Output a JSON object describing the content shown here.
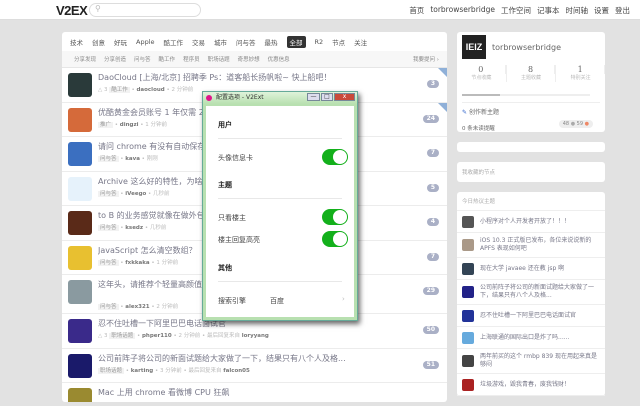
{
  "header": {
    "logo": "V2EX",
    "search_placeholder": "",
    "nav": [
      "首页",
      "torbrowserbridge",
      "工作空间",
      "记事本",
      "时间轴",
      "设置",
      "登出"
    ]
  },
  "tabs": [
    "技术",
    "创意",
    "好玩",
    "Apple",
    "酷工作",
    "交易",
    "城市",
    "问与答",
    "最热",
    "全部",
    "R2",
    "节点",
    "关注"
  ],
  "active_tab": "全部",
  "subtabs": [
    "分享发现",
    "分享创造",
    "问与答",
    "酷工作",
    "程序员",
    "职场话题",
    "奇思妙想",
    "优惠信息"
  ],
  "subtabs_more": "我要提问 ›",
  "topics": [
    {
      "title": "DaoCloud [上海/北京] 招聘季 Ps：道客船长扬帆啦~ 快上船吧！",
      "votes": "△ 3",
      "node": "酷工作",
      "user": "daocloud",
      "time": "2 分钟前",
      "last": "",
      "count": "3",
      "color": "#2a3a3a"
    },
    {
      "title": "优酷黄金会员账号 1 年仅需 2",
      "votes": "",
      "node": "推广",
      "user": "dingzi",
      "time": "1 分钟前",
      "last": "",
      "count": "24",
      "color": "#d56a3a"
    },
    {
      "title": "请问 chrome 有没有自动保存",
      "votes": "",
      "node": "问与答",
      "user": "kava",
      "time": "刚刚",
      "last": "",
      "count": "7",
      "color": "#3b6fc0"
    },
    {
      "title": "Archive 这么好的特性，为啥",
      "votes": "",
      "node": "问与答",
      "user": "iVeego",
      "time": "几秒前",
      "last": "",
      "count": "5",
      "color": "#e6f2fb"
    },
    {
      "title": "to B 的业务感觉就像在做外包",
      "votes": "",
      "node": "问与答",
      "user": "ksedz",
      "time": "几秒前",
      "last": "",
      "count": "4",
      "color": "#5a2a18"
    },
    {
      "title": "JavaScript 怎么清空数组？",
      "votes": "",
      "node": "问与答",
      "user": "fxkkaka",
      "time": "1 分钟前",
      "last": "",
      "count": "7",
      "color": "#e8c030"
    },
    {
      "title": "这年头，请推荐个轻量高颜值 get.adobe.com/cn/reader/) 109M 啊。。。",
      "votes": "",
      "node": "问与答",
      "user": "alex321",
      "time": "2 分钟前",
      "last": "",
      "count": "29",
      "color": "#8a9aa0",
      "tall": true
    },
    {
      "title": "忍不住吐槽一下阿里巴巴电话面试官",
      "votes": "△ 3",
      "node": "职场话题",
      "user": "phper110",
      "time": "2 分钟前",
      "last": "loryyang",
      "count": "50",
      "color": "#3a2a8a"
    },
    {
      "title": "公司前阵子将公司的新面试题给大家做了一下，结果只有八个人及格...",
      "votes": "",
      "node": "职场话题",
      "user": "karting",
      "time": "3 分钟前",
      "last": "falcon05",
      "count": "51",
      "color": "#1a1a6a"
    },
    {
      "title": "Mac 上用 chrome 看微博 CPU 狂飙",
      "votes": "",
      "node": "",
      "user": "",
      "time": "",
      "last": "",
      "count": "",
      "color": "#9a8a30"
    }
  ],
  "meta_labels": {
    "last_reply": "最后回复来自"
  },
  "profile": {
    "avatar_text": "IEIZ",
    "name": "torbrowserbridge",
    "stats": [
      {
        "n": "0",
        "l": "节点收藏"
      },
      {
        "n": "8",
        "l": "主题收藏"
      },
      {
        "n": "1",
        "l": "特别关注"
      }
    ],
    "progress": 0.3,
    "create": "创作新主题",
    "unread": "0 条未读提醒",
    "silver": "48",
    "bronze": "59"
  },
  "fav_nodes": "我收藏的节点",
  "hot": {
    "title": "今日热议主题",
    "items": [
      "小程序对个人开发者开放了！！！",
      "iOS 10.3 正式版已发布，各位来说说新的 APFS 表现如何吧",
      "现在大学 javaee 还在教 jsp 啊",
      "公司前阵子将公司的新面试题给大家做了一下，结果只有八个人及格...",
      "忍不住吐槽一下阿里巴巴电话面试官",
      "上海联通的国际出口是炸了吗......",
      "两年前买的这个 rmbp 839 现在用起来真是够闷",
      "垃圾游戏，毁我青春，废我钱财！"
    ],
    "colors": [
      "#555",
      "#a98",
      "#345",
      "#228",
      "#239",
      "#6ad",
      "#444",
      "#a22"
    ]
  },
  "dialog": {
    "title": "配置选项 - V2Ext",
    "min": "—",
    "max": "□",
    "close": "x",
    "sections": {
      "user": "用户",
      "topic": "主题",
      "other": "其他"
    },
    "options": {
      "avatar_card": "头像信息卡",
      "op_only": "只看楼主",
      "op_highlight": "楼主回复高亮",
      "search_engine": "搜索引擎",
      "search_engine_value": "百度"
    },
    "toggles": {
      "avatar_card": true,
      "op_only": true,
      "op_highlight": true
    }
  }
}
